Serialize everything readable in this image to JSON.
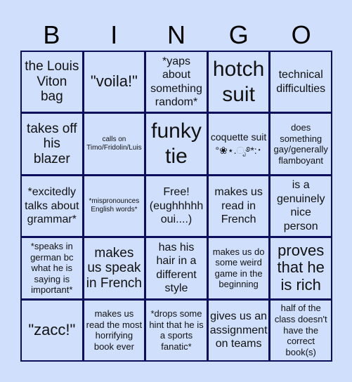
{
  "header": {
    "letters": [
      "B",
      "I",
      "N",
      "G",
      "O"
    ]
  },
  "colors": {
    "background": "#d0dffb",
    "grid_line": "#0d0d5e",
    "text": "#111111"
  },
  "cells": [
    [
      "the Louis Viton bag",
      "\"voila!\"",
      "*yaps about something random*",
      "hotch suit",
      "technical difficulties"
    ],
    [
      "takes off his blazer",
      "calls on Timo/Fridolin/Luis",
      "funky tie",
      "coquette suit °❀⋆.ೃ࿔*:･",
      "does something gay/generally flamboyant"
    ],
    [
      "*excitedly talks about grammar*",
      "*mispronounces English words*",
      "Free! (eughhhhh oui....)",
      "makes us read in French",
      "is a genuinely nice person"
    ],
    [
      "*speaks in german bc what he is saying is important*",
      "makes us speak in French",
      "has his hair in a different style",
      "makes us do some weird game in the beginning",
      "proves that he is rich"
    ],
    [
      "\"zacc!\"",
      "makes us read the most horrifying book ever",
      "*drops some hint that he is a sports fanatic*",
      "gives us an assignment on teams",
      "half of the class doesn't have the correct book(s)"
    ]
  ]
}
